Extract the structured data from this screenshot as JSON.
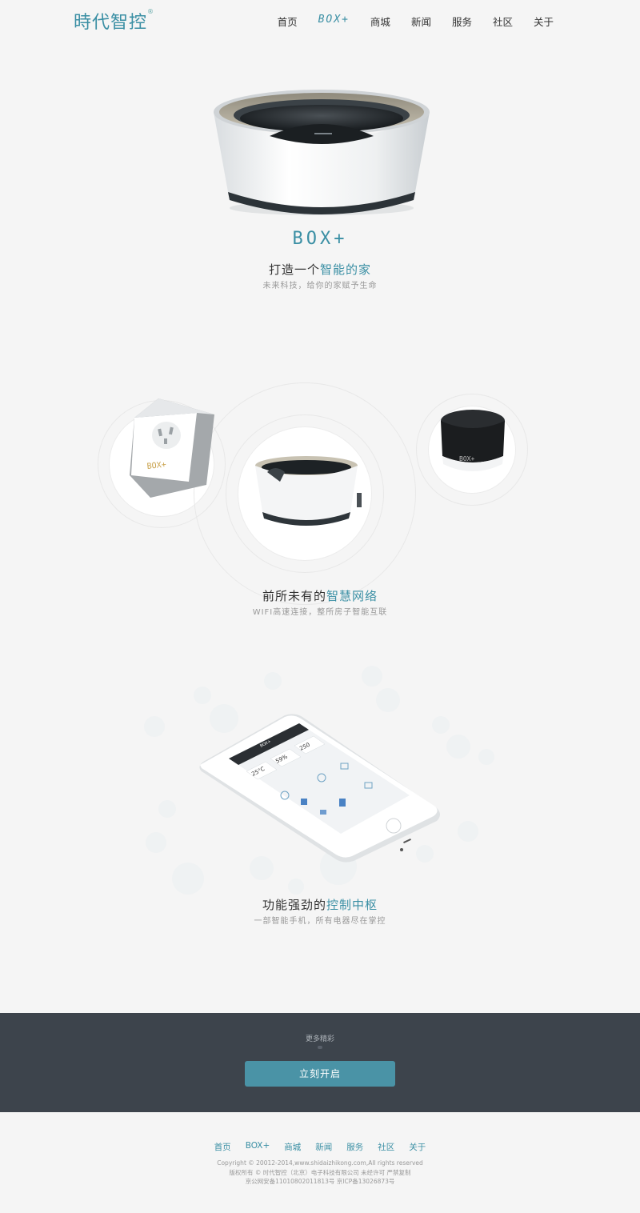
{
  "header": {
    "logo_text": "時代智控",
    "logo_mark": "®",
    "nav": [
      "首页",
      "BOX+",
      "商城",
      "新闻",
      "服务",
      "社区",
      "关于"
    ]
  },
  "hero": {
    "brand": "BOX+",
    "title_plain": "打造一个",
    "title_highlight": "智能的家",
    "subtitle": "未来科技，给你的家赋予生命"
  },
  "network": {
    "title_plain": "前所未有的",
    "title_highlight": "智慧网络",
    "subtitle": "WIFI高速连接，整所房子智能互联",
    "plug_label": "BOX+",
    "sensor_label": "BOX+"
  },
  "control": {
    "title_plain": "功能强劲的",
    "title_highlight": "控制中枢",
    "subtitle": "一部智能手机，所有电器尽在掌控",
    "phone": {
      "app_title": "BOX+",
      "temp": "25°C",
      "humidity": "59%",
      "pm": "250"
    }
  },
  "cta": {
    "more": "更多精彩",
    "button": "立刻开启"
  },
  "footer": {
    "nav": [
      "首页",
      "BOX+",
      "商城",
      "新闻",
      "服务",
      "社区",
      "关于"
    ],
    "copyright": "Copyright © 20012-2014,www.shidaizhikong.com,All rights reserved",
    "company": "版权所有 © 时代智控（北京）电子科技有限公司 未经许可 严禁复制",
    "icp": "京公网安备11010802011813号 京ICP备13026873号"
  },
  "colors": {
    "accent": "#3a8fa4",
    "cta_bg": "#3d444c",
    "button": "#4a93a6"
  }
}
